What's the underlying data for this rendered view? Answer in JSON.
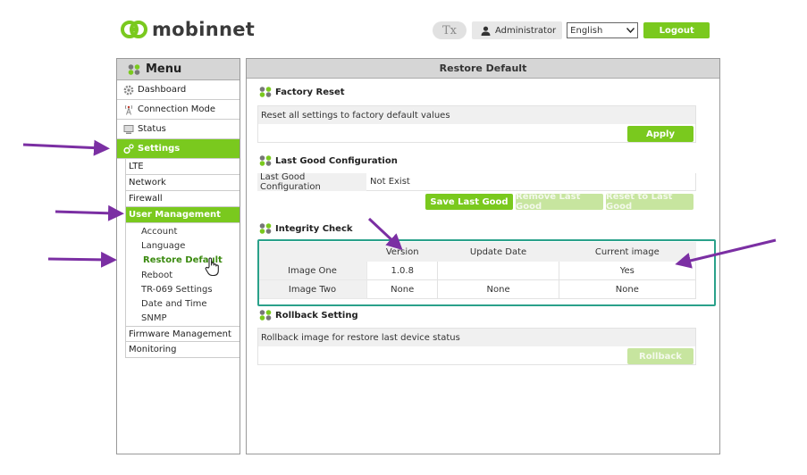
{
  "header": {
    "logo_text": "mobinnet",
    "clear_format_label": "Tx",
    "user_label": "Administrator",
    "language_value": "English",
    "logout_label": "Logout"
  },
  "sidebar": {
    "title": "Menu",
    "items": [
      {
        "label": "Dashboard",
        "icon": "gear-icon"
      },
      {
        "label": "Connection Mode",
        "icon": "antenna-icon"
      },
      {
        "label": "Status",
        "icon": "monitor-icon"
      },
      {
        "label": "Settings",
        "icon": "settings-icon"
      }
    ],
    "settings_sub": [
      "LTE",
      "Network",
      "Firewall",
      "User Management"
    ],
    "user_management_sub": [
      "Account",
      "Language",
      "Restore Default",
      "Reboot",
      "TR-069 Settings",
      "Date and Time",
      "SNMP"
    ],
    "after_sub": [
      "Firmware Management",
      "Monitoring"
    ]
  },
  "main": {
    "title": "Restore Default",
    "factory_reset": {
      "title": "Factory Reset",
      "description": "Reset all settings to factory default values",
      "apply_label": "Apply"
    },
    "last_good": {
      "title": "Last Good Configuration",
      "label": "Last Good Configuration",
      "value": "Not Exist",
      "save_label": "Save Last Good",
      "remove_label": "Remove Last Good",
      "reset_label": "Reset to Last Good"
    },
    "integrity": {
      "title": "Integrity Check",
      "headers": [
        "",
        "Version",
        "Update Date",
        "Current image"
      ],
      "rows": [
        [
          "Image One",
          "1.0.8",
          "",
          "Yes"
        ],
        [
          "Image Two",
          "None",
          "None",
          "None"
        ]
      ]
    },
    "rollback": {
      "title": "Rollback Setting",
      "description": "Rollback image for restore last device status",
      "rollback_label": "Rollback"
    }
  },
  "colors": {
    "accent_green": "#7ac91e",
    "highlight_teal": "#2aa18a",
    "annotation_purple": "#7b2fa3"
  }
}
